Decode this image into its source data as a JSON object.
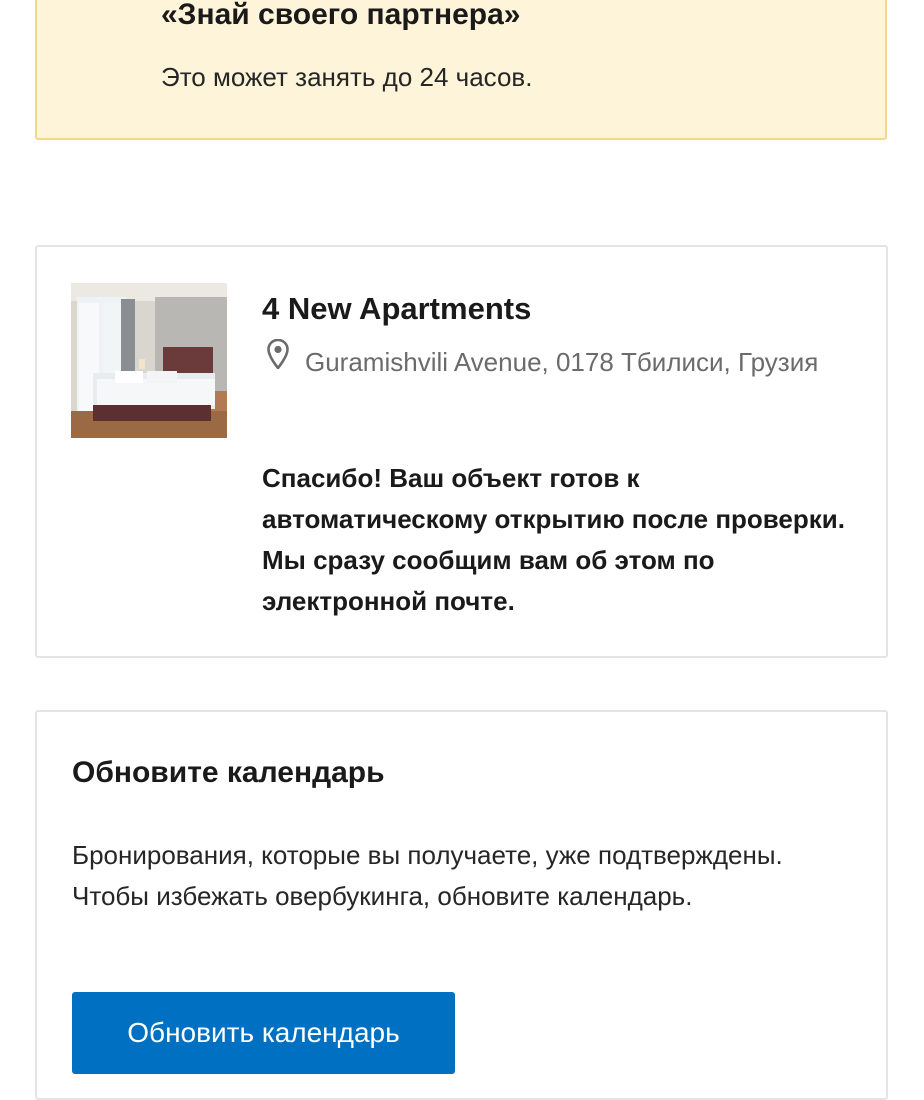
{
  "notice": {
    "title": "«Знай своего партнера»",
    "text": "Это может занять до 24 часов."
  },
  "property": {
    "name": "4 New Apartments",
    "address": "Guramishvili Avenue, 0178 Тбилиси, Грузия",
    "message": "Спасибо! Ваш объект готов к автоматическому открытию после проверки. Мы сразу сообщим вам об этом по электронной почте.",
    "icon": "location-pin-icon"
  },
  "calendar": {
    "title": "Обновите календарь",
    "text": "Бронирования, которые вы получаете, уже подтверждены. Чтобы избежать овербукинга, обновите календарь.",
    "button_label": "Обновить календарь"
  },
  "colors": {
    "notice_bg": "#fdf4d9",
    "notice_border": "#f2d88e",
    "button_blue": "#0071c2"
  }
}
